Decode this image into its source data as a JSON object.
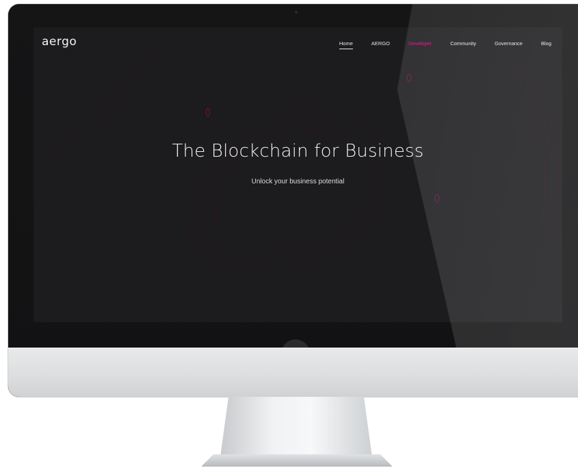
{
  "site": {
    "logo_text": "aergo",
    "nav": [
      {
        "label": "Home",
        "state": "active"
      },
      {
        "label": "AERGO",
        "state": "normal"
      },
      {
        "label": "Developer",
        "state": "highlight"
      },
      {
        "label": "Community",
        "state": "normal"
      },
      {
        "label": "Governance",
        "state": "normal"
      },
      {
        "label": "Blog",
        "state": "normal"
      }
    ],
    "hero": {
      "title": "The Blockchain for Business",
      "subtitle": "Unlock your business potential"
    }
  },
  "colors": {
    "accent": "#e3007f",
    "screen_bg": "#1c1b1d",
    "text": "#f2f2f2"
  },
  "icons": {
    "logo": "aergo-logo-icon"
  }
}
